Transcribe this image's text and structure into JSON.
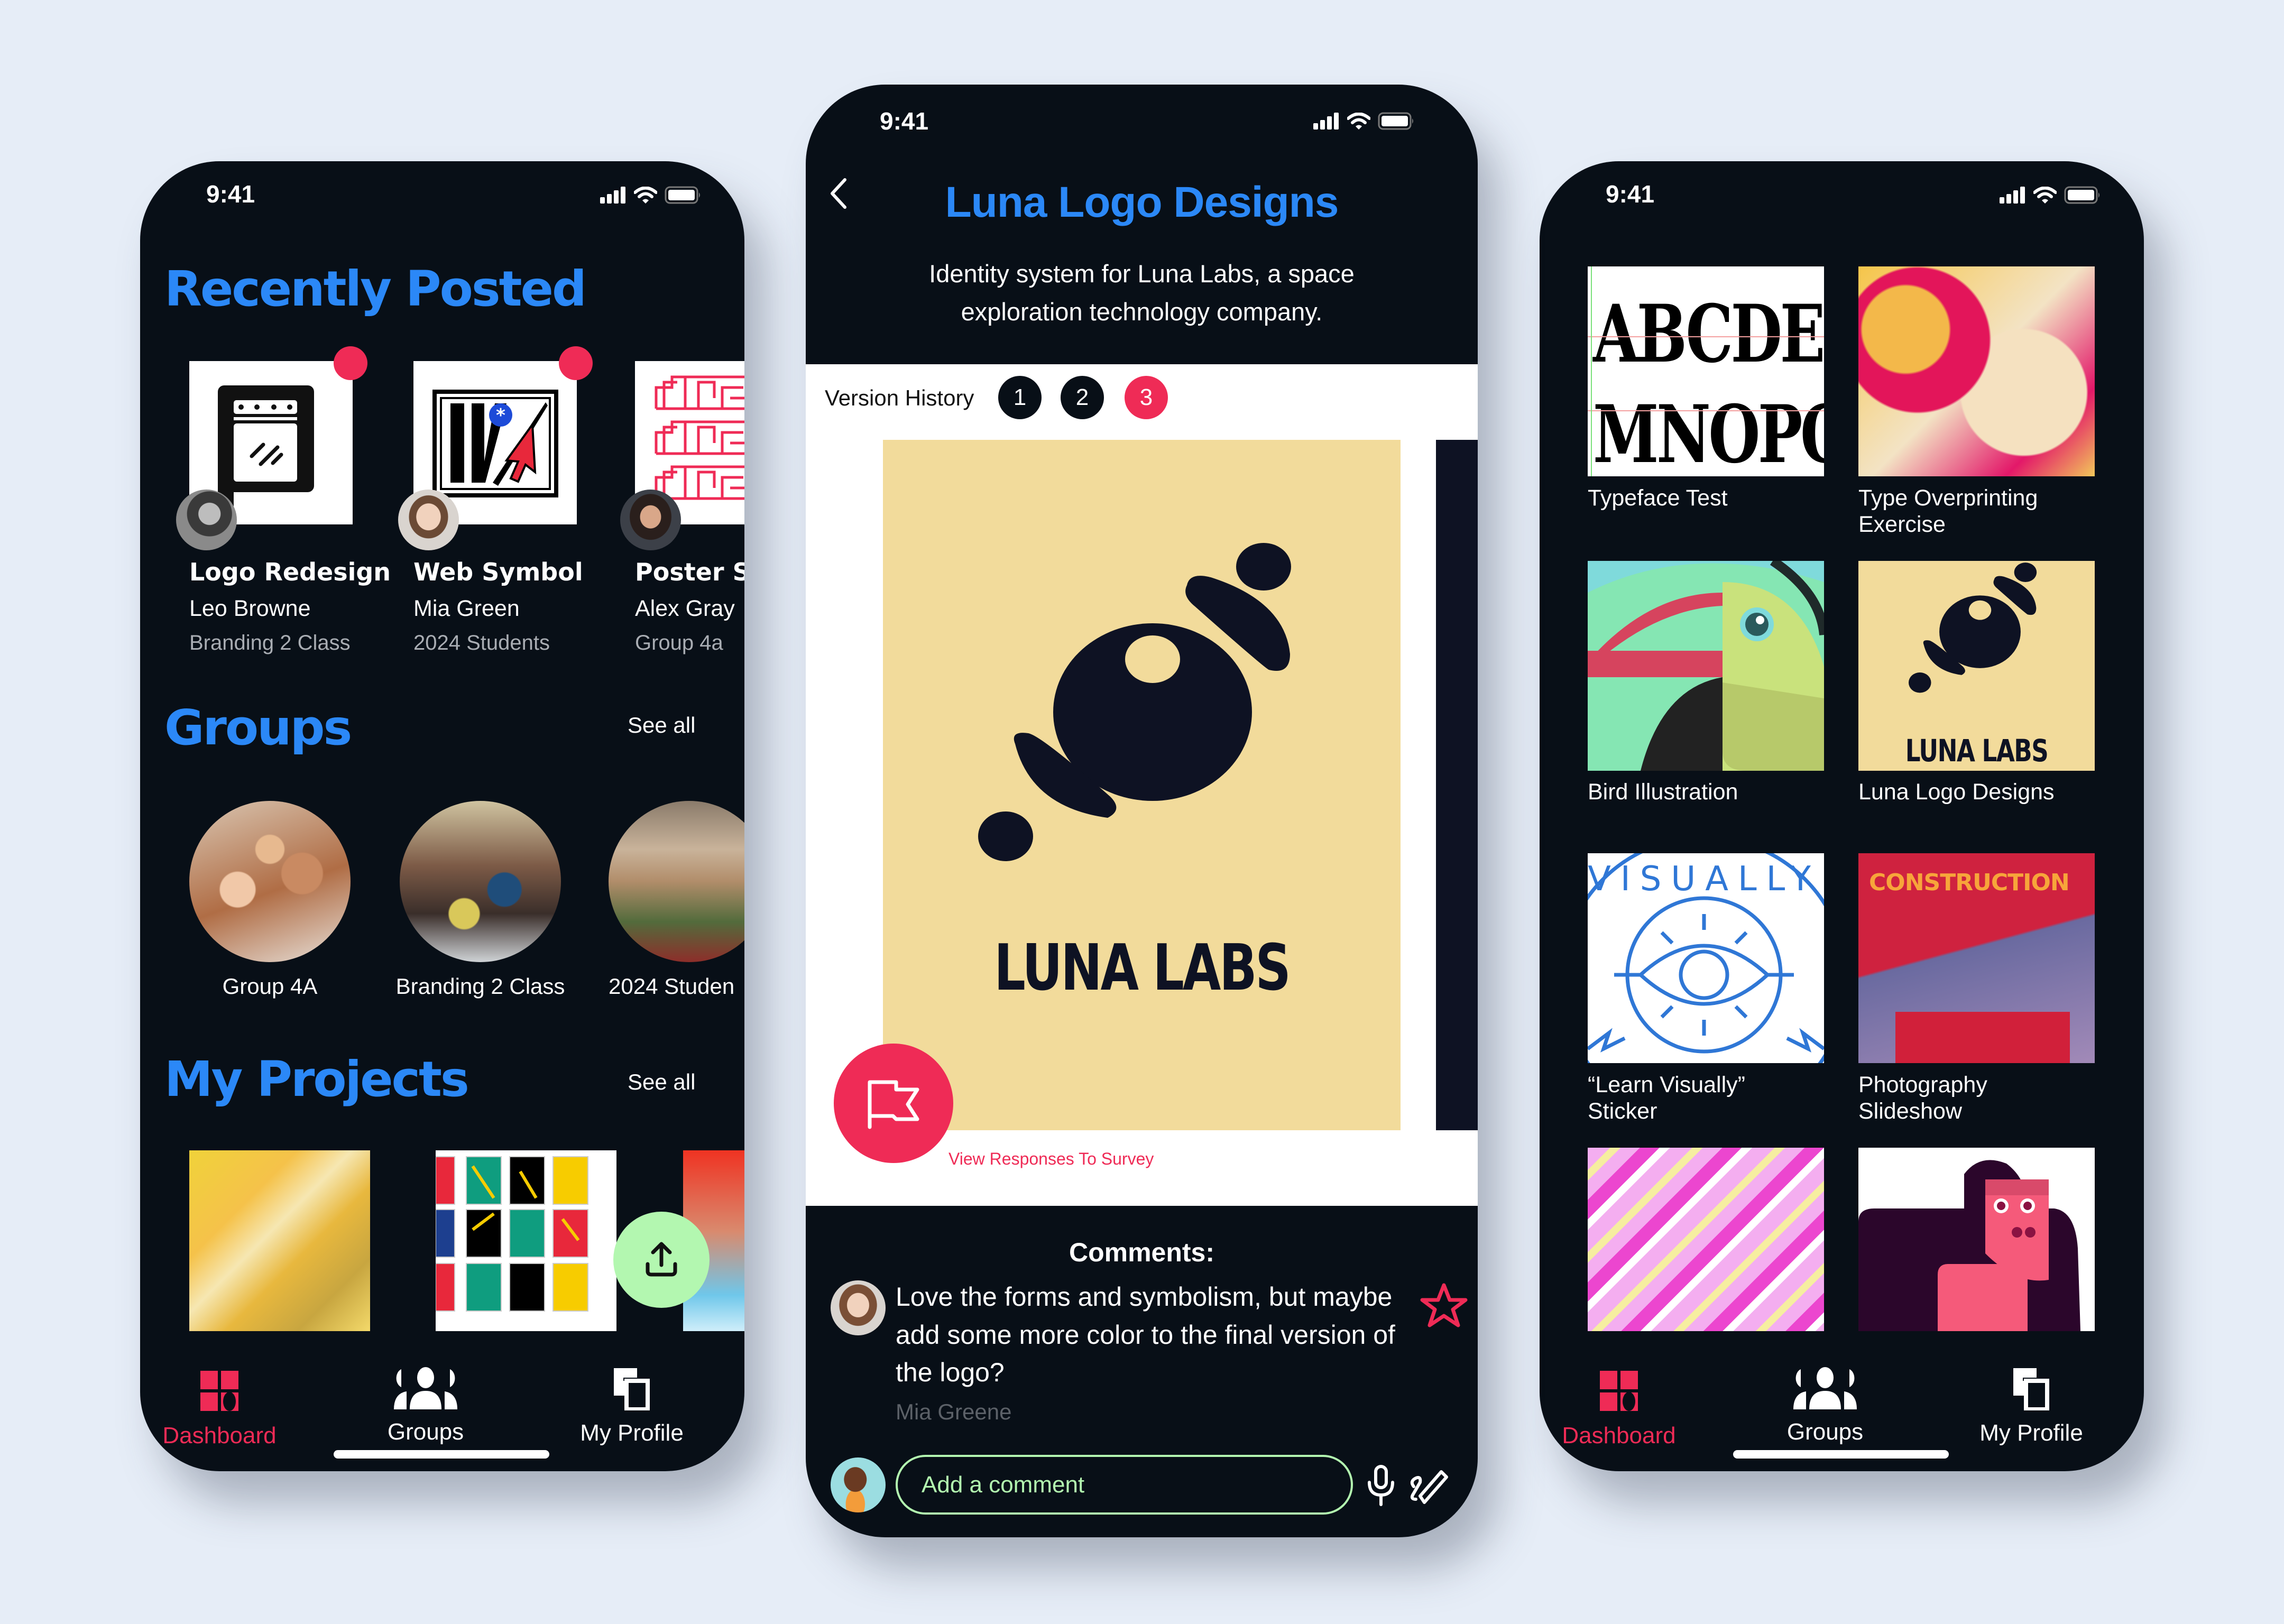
{
  "colors": {
    "background": "#e6edf7",
    "phone": "#080f17",
    "accent_blue": "#2b88f7",
    "accent_red": "#ef2b56",
    "accent_green": "#b3f7b0",
    "poster_yellow": "#f2db9b"
  },
  "status_bar": {
    "time": "9:41",
    "icons": [
      "signal-icon",
      "wifi-icon",
      "battery-icon"
    ]
  },
  "dashboard": {
    "recently_posted": {
      "heading": "Recently Posted",
      "items": [
        {
          "title": "Logo Redesign",
          "author": "Leo Browne",
          "group": "Branding 2 Class",
          "unread": true
        },
        {
          "title": "Web Symbol",
          "author": "Mia Green",
          "group": "2024 Students",
          "unread": true
        },
        {
          "title": "Poster Se",
          "author": "Alex Gray",
          "group": "Group 4a",
          "unread": false
        }
      ]
    },
    "groups": {
      "heading": "Groups",
      "see_all": "See all",
      "items": [
        {
          "label": "Group 4A"
        },
        {
          "label": "Branding 2 Class"
        },
        {
          "label": "2024 Studen"
        }
      ]
    },
    "my_projects": {
      "heading": "My Projects",
      "see_all": "See all"
    },
    "fab": {
      "icon": "upload-icon"
    }
  },
  "nav": {
    "items": [
      {
        "label": "Dashboard",
        "icon": "dashboard-icon",
        "active": true
      },
      {
        "label": "Groups",
        "icon": "groups-icon",
        "active": false
      },
      {
        "label": "My Profile",
        "icon": "profile-icon",
        "active": false
      }
    ]
  },
  "project_detail": {
    "title": "Luna Logo Designs",
    "description_line1": "Identity system for Luna Labs, a space",
    "description_line2": "exploration technology company.",
    "version_history_label": "Version History",
    "versions": [
      "1",
      "2",
      "3"
    ],
    "active_version": "3",
    "poster_text": "LUNA LABS",
    "survey_link": "View Responses To Survey",
    "comments_heading": "Comments:",
    "comment": {
      "line1": "Love the forms and symbolism, but maybe",
      "line2": "add some more color to the final version of",
      "line3": "the logo?",
      "author": "Mia Greene"
    },
    "comment_input_placeholder": "Add a comment"
  },
  "profile_grid": {
    "items": [
      {
        "label_line1": "Typeface Test",
        "label_line2": ""
      },
      {
        "label_line1": "Type Overprinting",
        "label_line2": "Exercise"
      },
      {
        "label_line1": "Bird Illustration",
        "label_line2": ""
      },
      {
        "label_line1": "Luna Logo Designs",
        "label_line2": ""
      },
      {
        "label_line1": "“Learn Visually”",
        "label_line2": "Sticker"
      },
      {
        "label_line1": "Photography",
        "label_line2": "Slideshow"
      },
      {
        "label_line1": "",
        "label_line2": ""
      },
      {
        "label_line1": "",
        "label_line2": ""
      }
    ],
    "thumb_texts": {
      "typeface_row1": "ABCDE",
      "typeface_row2": "MNOPQ",
      "construction": "CONSTRUCTION",
      "luna_small": "LUNA LABS",
      "sticker": "LEARN·VISUALLY"
    }
  }
}
